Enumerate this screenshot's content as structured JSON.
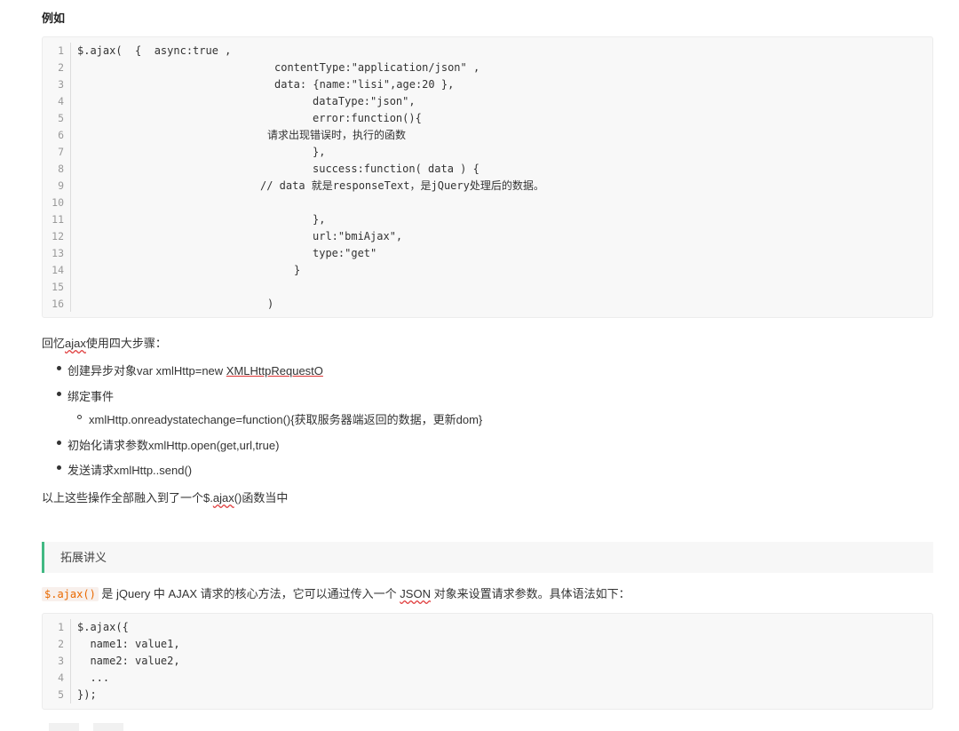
{
  "heading": "例如",
  "code_block_1": {
    "lines": [
      {
        "n": "1",
        "text": "$.ajax(  {  async:true ,",
        "indent": 39
      },
      {
        "n": "2",
        "text": "contentType:\"application/json\" ,",
        "indent": 261
      },
      {
        "n": "3",
        "text": "data: {name:\"lisi\",age:20 },",
        "indent": 261
      },
      {
        "n": "4",
        "text": "dataType:\"json\",",
        "indent": 304
      },
      {
        "n": "5",
        "text": "error:function(){",
        "indent": 304
      },
      {
        "n": "6",
        "text": "请求出现错误时，执行的函数",
        "indent": 253
      },
      {
        "n": "7",
        "text": "},",
        "indent": 304
      },
      {
        "n": "8",
        "text": "success:function( data ) {",
        "indent": 304
      },
      {
        "n": "9",
        "text": "// data 就是responseText，是jQuery处理后的数据。",
        "indent": 245
      },
      {
        "n": "10",
        "text": "",
        "indent": 0
      },
      {
        "n": "11",
        "text": "},",
        "indent": 304
      },
      {
        "n": "12",
        "text": "url:\"bmiAjax\",",
        "indent": 304
      },
      {
        "n": "13",
        "text": "type:\"get\"",
        "indent": 304
      },
      {
        "n": "14",
        "text": "}",
        "indent": 283
      },
      {
        "n": "15",
        "text": "",
        "indent": 0
      },
      {
        "n": "16",
        "text": ")",
        "indent": 253
      }
    ]
  },
  "recall": {
    "prefix": "回忆",
    "word": "ajax",
    "suffix": "使用四大步骤："
  },
  "steps": {
    "step1_text": "创建异步对象var xmlHttp=new ",
    "step1_link": "XMLHttpRequestO",
    "step2": "绑定事件",
    "step2_sub": "xmlHttp.onreadystatechange=function(){获取服务器端返回的数据，更新dom}",
    "step3": "初始化请求参数xmlHttp.open(get,url,true)",
    "step4": "发送请求xmlHttp..send()"
  },
  "summary": {
    "prefix": "以上这些操作全部融入到了一个$.",
    "word": "ajax",
    "suffix": "()函数当中"
  },
  "callout": {
    "text": "拓展讲义",
    "accent_color": "#42b983"
  },
  "intro": {
    "code": "$.ajax()",
    "text_before_json": " 是 jQuery 中 AJAX 请求的核心方法，它可以通过传入一个 ",
    "json_word": "JSON",
    "text_after_json": " 对象来设置请求参数。具体语法如下："
  },
  "code_block_2": {
    "lines": [
      {
        "n": "1",
        "text": "$.ajax({"
      },
      {
        "n": "2",
        "text": "  name1: value1,"
      },
      {
        "n": "3",
        "text": "  name2: value2,"
      },
      {
        "n": "4",
        "text": "  ..."
      },
      {
        "n": "5",
        "text": "});"
      }
    ]
  }
}
